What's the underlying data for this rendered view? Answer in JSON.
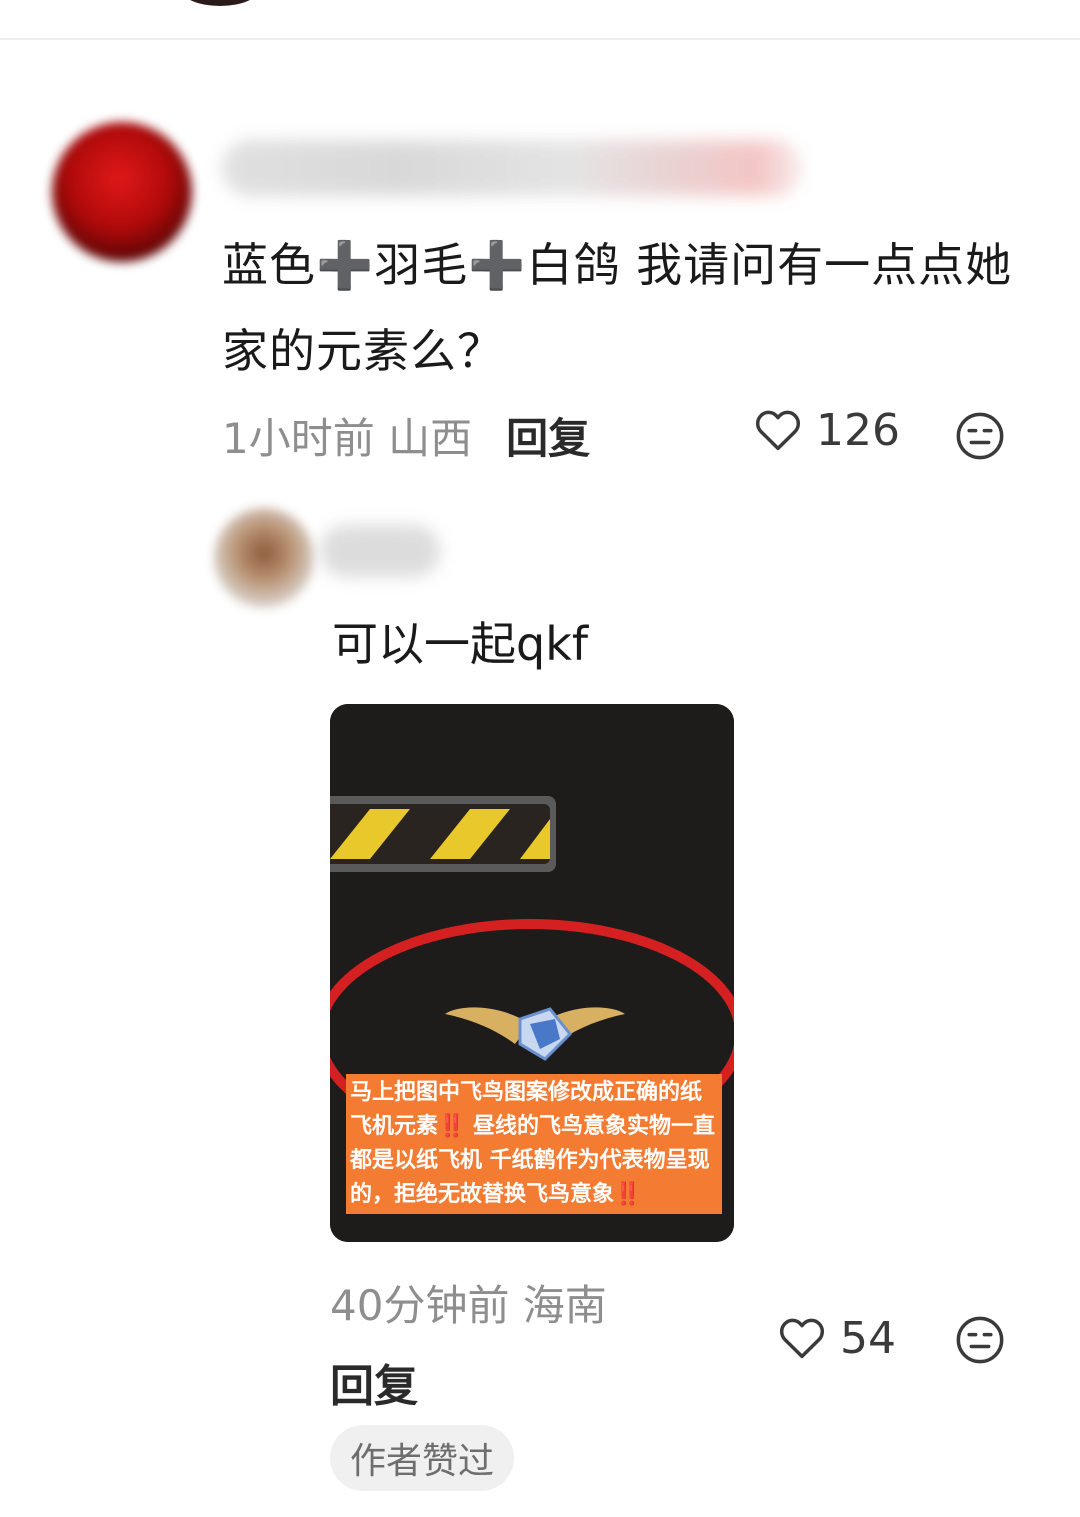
{
  "comment": {
    "text": "蓝色➕羽毛➕白鸽 我请问有一点点她家的元素么？",
    "time_location": "1小时前 山西",
    "reply_label": "回复",
    "like_count": "126"
  },
  "reply": {
    "text": "可以一起qkf",
    "image": {
      "overlay_text": "马上把图中飞鸟图案修改成正确的纸飞机元素‼️  昼线的飞鸟意象实物一直都是以纸飞机 千纸鹤作为代表物呈现的，拒绝无故替换飞鸟意象‼️"
    },
    "time_location": "40分钟前 海南",
    "reply_label": "回复",
    "like_count": "54",
    "author_liked": "作者赞过"
  },
  "icons": {
    "like": "heart-outline-icon",
    "dislike": "neutral-face-icon"
  },
  "colors": {
    "overlay_orange": "#f47b32",
    "meta_gray": "#8e8e8e"
  }
}
